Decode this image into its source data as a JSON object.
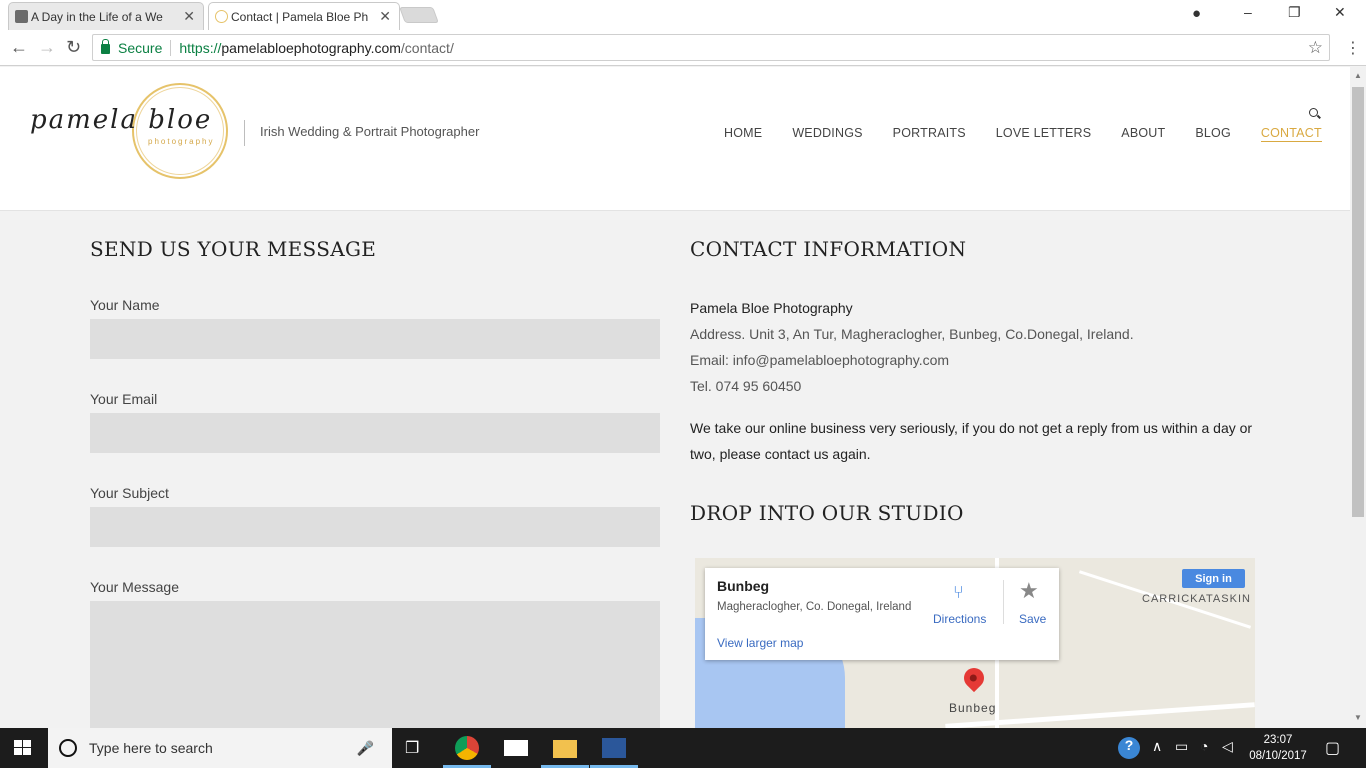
{
  "browser": {
    "tabs": [
      {
        "title": "A Day in the Life of a We",
        "close": "✕"
      },
      {
        "title": "Contact | Pamela Bloe Ph",
        "close": "✕"
      }
    ],
    "window_controls": {
      "minimize": "–",
      "maximize": "❐",
      "close": "✕"
    },
    "secure_label": "Secure",
    "url_scheme": "https://",
    "url_host": "pamelabloephotography.com",
    "url_path": "/contact/"
  },
  "site": {
    "logo_text": "pamela bloe",
    "logo_sub": "photography",
    "tagline": "Irish Wedding & Portrait Photographer",
    "nav": [
      "HOME",
      "WEDDINGS",
      "PORTRAITS",
      "LOVE LETTERS",
      "ABOUT",
      "BLOG",
      "CONTACT"
    ],
    "active_nav": "CONTACT",
    "accent_color": "#d9a941"
  },
  "form": {
    "heading": "SEND US YOUR MESSAGE",
    "name_label": "Your Name",
    "email_label": "Your Email",
    "subject_label": "Your Subject",
    "message_label": "Your Message"
  },
  "contact": {
    "heading": "CONTACT INFORMATION",
    "business": "Pamela Bloe Photography",
    "address": "Address. Unit 3, An Tur, Magheraclogher, Bunbeg, Co.Donegal, Ireland.",
    "email": "Email: info@pamelabloephotography.com",
    "tel": "Tel. 074 95 60450",
    "note": "We take our online business very seriously, if you do not get a reply from us within a day or two, please contact us again.",
    "studio_heading": "DROP INTO OUR STUDIO"
  },
  "map": {
    "place": "Bunbeg",
    "address": "Magheraclogher, Co. Donegal, Ireland",
    "directions": "Directions",
    "save": "Save",
    "view_larger": "View larger map",
    "sign_in": "Sign in",
    "label_town": "Bunbeg",
    "label_area": "CARRICKATASKIN"
  },
  "taskbar": {
    "search_placeholder": "Type here to search",
    "time": "23:07",
    "date": "08/10/2017"
  }
}
